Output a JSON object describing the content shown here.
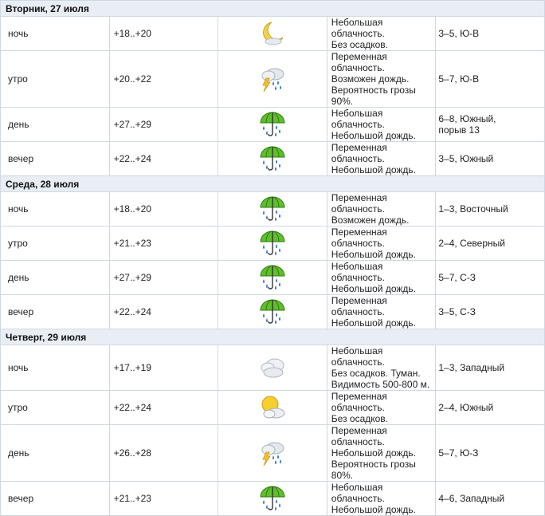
{
  "days": [
    {
      "title": "Вторник, 27 июля",
      "rows": [
        {
          "time": "ночь",
          "temp": "+18..+20",
          "icon": "moon-cloud-icon",
          "desc1": "Небольшая облачность.",
          "desc2": "Без осадков.",
          "wind1": "3–5, Ю-В",
          "wind2": ""
        },
        {
          "time": "утро",
          "temp": "+20..+22",
          "icon": "thunder-rain-cloud-icon",
          "desc1": "Переменная облачность.",
          "desc2": "Возможен дождь. Вероятность грозы 90%.",
          "wind1": "5–7, Ю-В",
          "wind2": ""
        },
        {
          "time": "день",
          "temp": "+27..+29",
          "icon": "umbrella-rain-icon",
          "desc1": "Небольшая облачность.",
          "desc2": "Небольшой дождь.",
          "wind1": "6–8, Южный,",
          "wind2": "порыв 13"
        },
        {
          "time": "вечер",
          "temp": "+22..+24",
          "icon": "umbrella-rain-icon",
          "desc1": "Переменная облачность.",
          "desc2": "Небольшой дождь.",
          "wind1": "3–5, Южный",
          "wind2": ""
        }
      ]
    },
    {
      "title": "Среда, 28 июля",
      "rows": [
        {
          "time": "ночь",
          "temp": "+18..+20",
          "icon": "umbrella-rain-icon",
          "desc1": "Переменная облачность.",
          "desc2": "Возможен дождь.",
          "wind1": "1–3, Восточный",
          "wind2": ""
        },
        {
          "time": "утро",
          "temp": "+21..+23",
          "icon": "umbrella-rain-icon",
          "desc1": "Переменная облачность.",
          "desc2": "Небольшой дождь.",
          "wind1": "2–4, Северный",
          "wind2": ""
        },
        {
          "time": "день",
          "temp": "+27..+29",
          "icon": "umbrella-rain-icon",
          "desc1": "Небольшая облачность.",
          "desc2": "Небольшой дождь.",
          "wind1": "5–7, С-З",
          "wind2": ""
        },
        {
          "time": "вечер",
          "temp": "+22..+24",
          "icon": "umbrella-rain-icon",
          "desc1": "Переменная облачность.",
          "desc2": "Небольшой дождь.",
          "wind1": "3–5, С-З",
          "wind2": ""
        }
      ]
    },
    {
      "title": "Четверг, 29 июля",
      "rows": [
        {
          "time": "ночь",
          "temp": "+17..+19",
          "icon": "cloud-fog-icon",
          "desc1": "Небольшая облачность.",
          "desc2": "Без осадков. Туман. Видимость 500-800 м.",
          "wind1": "1–3, Западный",
          "wind2": ""
        },
        {
          "time": "утро",
          "temp": "+22..+24",
          "icon": "sun-cloud-icon",
          "desc1": "Переменная облачность.",
          "desc2": "Без осадков.",
          "wind1": "2–4, Южный",
          "wind2": ""
        },
        {
          "time": "день",
          "temp": "+26..+28",
          "icon": "thunder-rain-cloud-icon",
          "desc1": "Переменная облачность.",
          "desc2": "Небольшой дождь. Вероятность грозы 80%.",
          "wind1": "5–7, Ю-З",
          "wind2": ""
        },
        {
          "time": "вечер",
          "temp": "+21..+23",
          "icon": "umbrella-rain-icon",
          "desc1": "Небольшая облачность.",
          "desc2": "Небольшой дождь.",
          "wind1": "4–6, Западный",
          "wind2": ""
        }
      ]
    }
  ]
}
